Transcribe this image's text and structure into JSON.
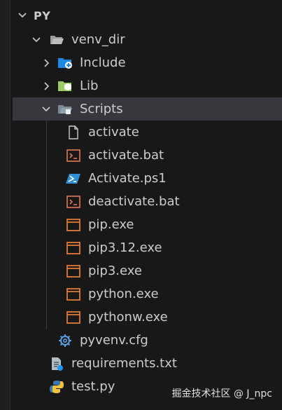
{
  "section": {
    "title": "PY"
  },
  "tree": {
    "venv_dir": "venv_dir",
    "include": "Include",
    "lib": "Lib",
    "scripts": "Scripts",
    "activate": "activate",
    "activate_bat": "activate.bat",
    "activate_ps1": "Activate.ps1",
    "deactivate_bat": "deactivate.bat",
    "pip_exe": "pip.exe",
    "pip312_exe": "pip3.12.exe",
    "pip3_exe": "pip3.exe",
    "python_exe": "python.exe",
    "pythonw_exe": "pythonw.exe",
    "pyvenv_cfg": "pyvenv.cfg",
    "requirements_txt": "requirements.txt",
    "test_py": "test.py"
  },
  "watermark": "掘金技术社区 @ J_npc",
  "colors": {
    "background": "#181818",
    "selected_row": "#37373d",
    "folder_blue": "#4aa3df",
    "bat_orange": "#e3765a",
    "exe_orange": "#e07b39",
    "powershell_blue": "#2f8fd6",
    "gear_blue": "#5aa0e6",
    "lib_green": "#8bc34a"
  }
}
